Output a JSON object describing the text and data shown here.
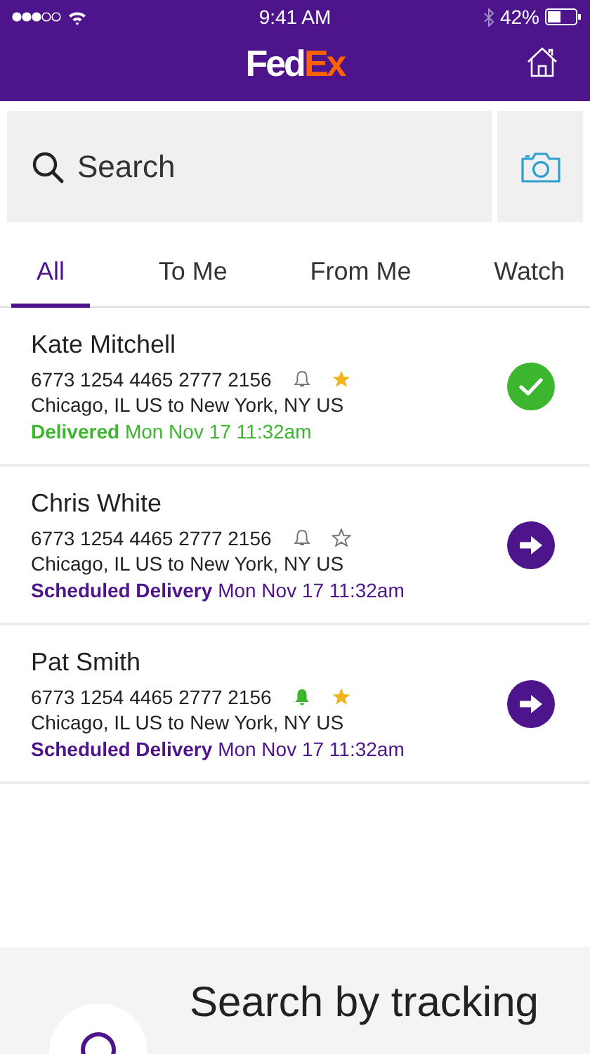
{
  "status_bar": {
    "time": "9:41 AM",
    "battery": "42%"
  },
  "header": {
    "logo_first": "Fed",
    "logo_second": "Ex"
  },
  "search": {
    "placeholder": "Search"
  },
  "tabs": [
    {
      "label": "All",
      "selected": true
    },
    {
      "label": "To Me",
      "selected": false
    },
    {
      "label": "From Me",
      "selected": false
    },
    {
      "label": "Watch",
      "selected": false
    }
  ],
  "shipments": [
    {
      "name": "Kate Mitchell",
      "tracking": "6773 1254 4465 2777 2156",
      "alert": false,
      "watched": true,
      "route": "Chicago, IL US to New York, NY US",
      "status": "Delivered",
      "date": "Mon Nov 17 11:32am",
      "kind": "delivered"
    },
    {
      "name": "Chris White",
      "tracking": "6773 1254 4465 2777 2156",
      "alert": false,
      "watched": false,
      "route": "Chicago, IL US to New York, NY US",
      "status": "Scheduled Delivery",
      "date": "Mon Nov 17 11:32am",
      "kind": "scheduled"
    },
    {
      "name": "Pat Smith",
      "tracking": "6773 1254 4465 2777 2156",
      "alert": true,
      "watched": true,
      "route": "Chicago, IL US to New York, NY US",
      "status": "Scheduled Delivery",
      "date": "Mon Nov 17 11:32am",
      "kind": "scheduled"
    }
  ],
  "promo": {
    "lines": [
      "Search by tracking"
    ]
  }
}
